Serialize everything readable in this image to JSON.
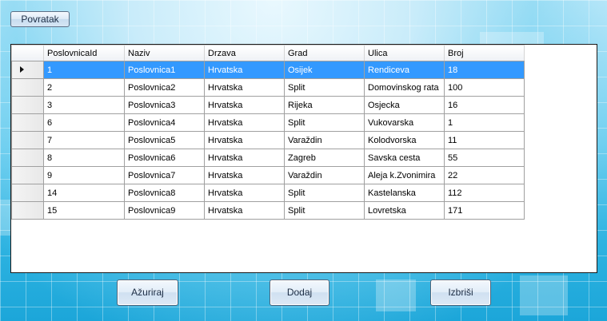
{
  "back_button": "Povratak",
  "grid": {
    "columns": [
      "PoslovnicaId",
      "Naziv",
      "Drzava",
      "Grad",
      "Ulica",
      "Broj"
    ],
    "rows": [
      [
        "1",
        "Poslovnica1",
        "Hrvatska",
        "Osijek",
        "Rendiceva",
        "18"
      ],
      [
        "2",
        "Poslovnica2",
        "Hrvatska",
        "Split",
        "Domovinskog rata",
        "100"
      ],
      [
        "3",
        "Poslovnica3",
        "Hrvatska",
        "Rijeka",
        "Osjecka",
        "16"
      ],
      [
        "6",
        "Poslovnica4",
        "Hrvatska",
        "Split",
        "Vukovarska",
        "1"
      ],
      [
        "7",
        "Poslovnica5",
        "Hrvatska",
        "Varaždin",
        "Kolodvorska",
        "11"
      ],
      [
        "8",
        "Poslovnica6",
        "Hrvatska",
        "Zagreb",
        "Savska cesta",
        "55"
      ],
      [
        "9",
        "Poslovnica7",
        "Hrvatska",
        "Varaždin",
        "Aleja k.Zvonimira",
        "22"
      ],
      [
        "14",
        "Poslovnica8",
        "Hrvatska",
        "Split",
        "Kastelanska",
        "112"
      ],
      [
        "15",
        "Poslovnica9",
        "Hrvatska",
        "Split",
        "Lovretska",
        "171"
      ]
    ],
    "selected_row": 0
  },
  "buttons": {
    "update": "Ažuriraj",
    "add": "Dodaj",
    "delete": "Izbriši"
  },
  "colors": {
    "selection": "#3399ff",
    "background": "#29b1df"
  }
}
